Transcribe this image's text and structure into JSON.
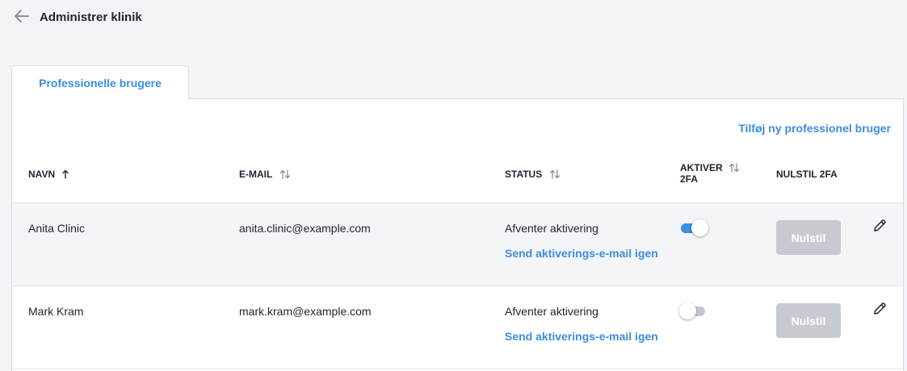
{
  "header": {
    "title": "Administrer klinik",
    "back_icon": "arrow-left-icon"
  },
  "tabs": [
    {
      "label": "Professionelle brugere",
      "active": true
    }
  ],
  "panel": {
    "add_user_label": "Tilføj ny professionel bruger"
  },
  "table": {
    "columns": [
      {
        "label": "NAVN",
        "sort_icon": "sort-ascending-icon"
      },
      {
        "label": "E-MAIL",
        "sort_icon": "sort-both-icon"
      },
      {
        "label": "STATUS",
        "sort_icon": "sort-both-icon"
      },
      {
        "label_line1": "AKTIVER",
        "label_line2": "2FA",
        "sort_icon": "sort-both-icon"
      },
      {
        "label": "NULSTIL 2FA"
      }
    ],
    "rows": [
      {
        "name": "Anita Clinic",
        "email": "anita.clinic@example.com",
        "status": "Afventer aktivering",
        "resend_label": "Send aktiverings-e-mail igen",
        "twofa_enabled": true,
        "reset_label": "Nulstil",
        "edit_icon": "pencil-icon"
      },
      {
        "name": "Mark Kram",
        "email": "mark.kram@example.com",
        "status": "Afventer aktivering",
        "resend_label": "Send aktiverings-e-mail igen",
        "twofa_enabled": false,
        "reset_label": "Nulstil",
        "edit_icon": "pencil-icon"
      }
    ]
  },
  "colors": {
    "accent": "#3b8ee2",
    "background": "#f3f4f7",
    "button_disabled": "#c7cad1"
  }
}
